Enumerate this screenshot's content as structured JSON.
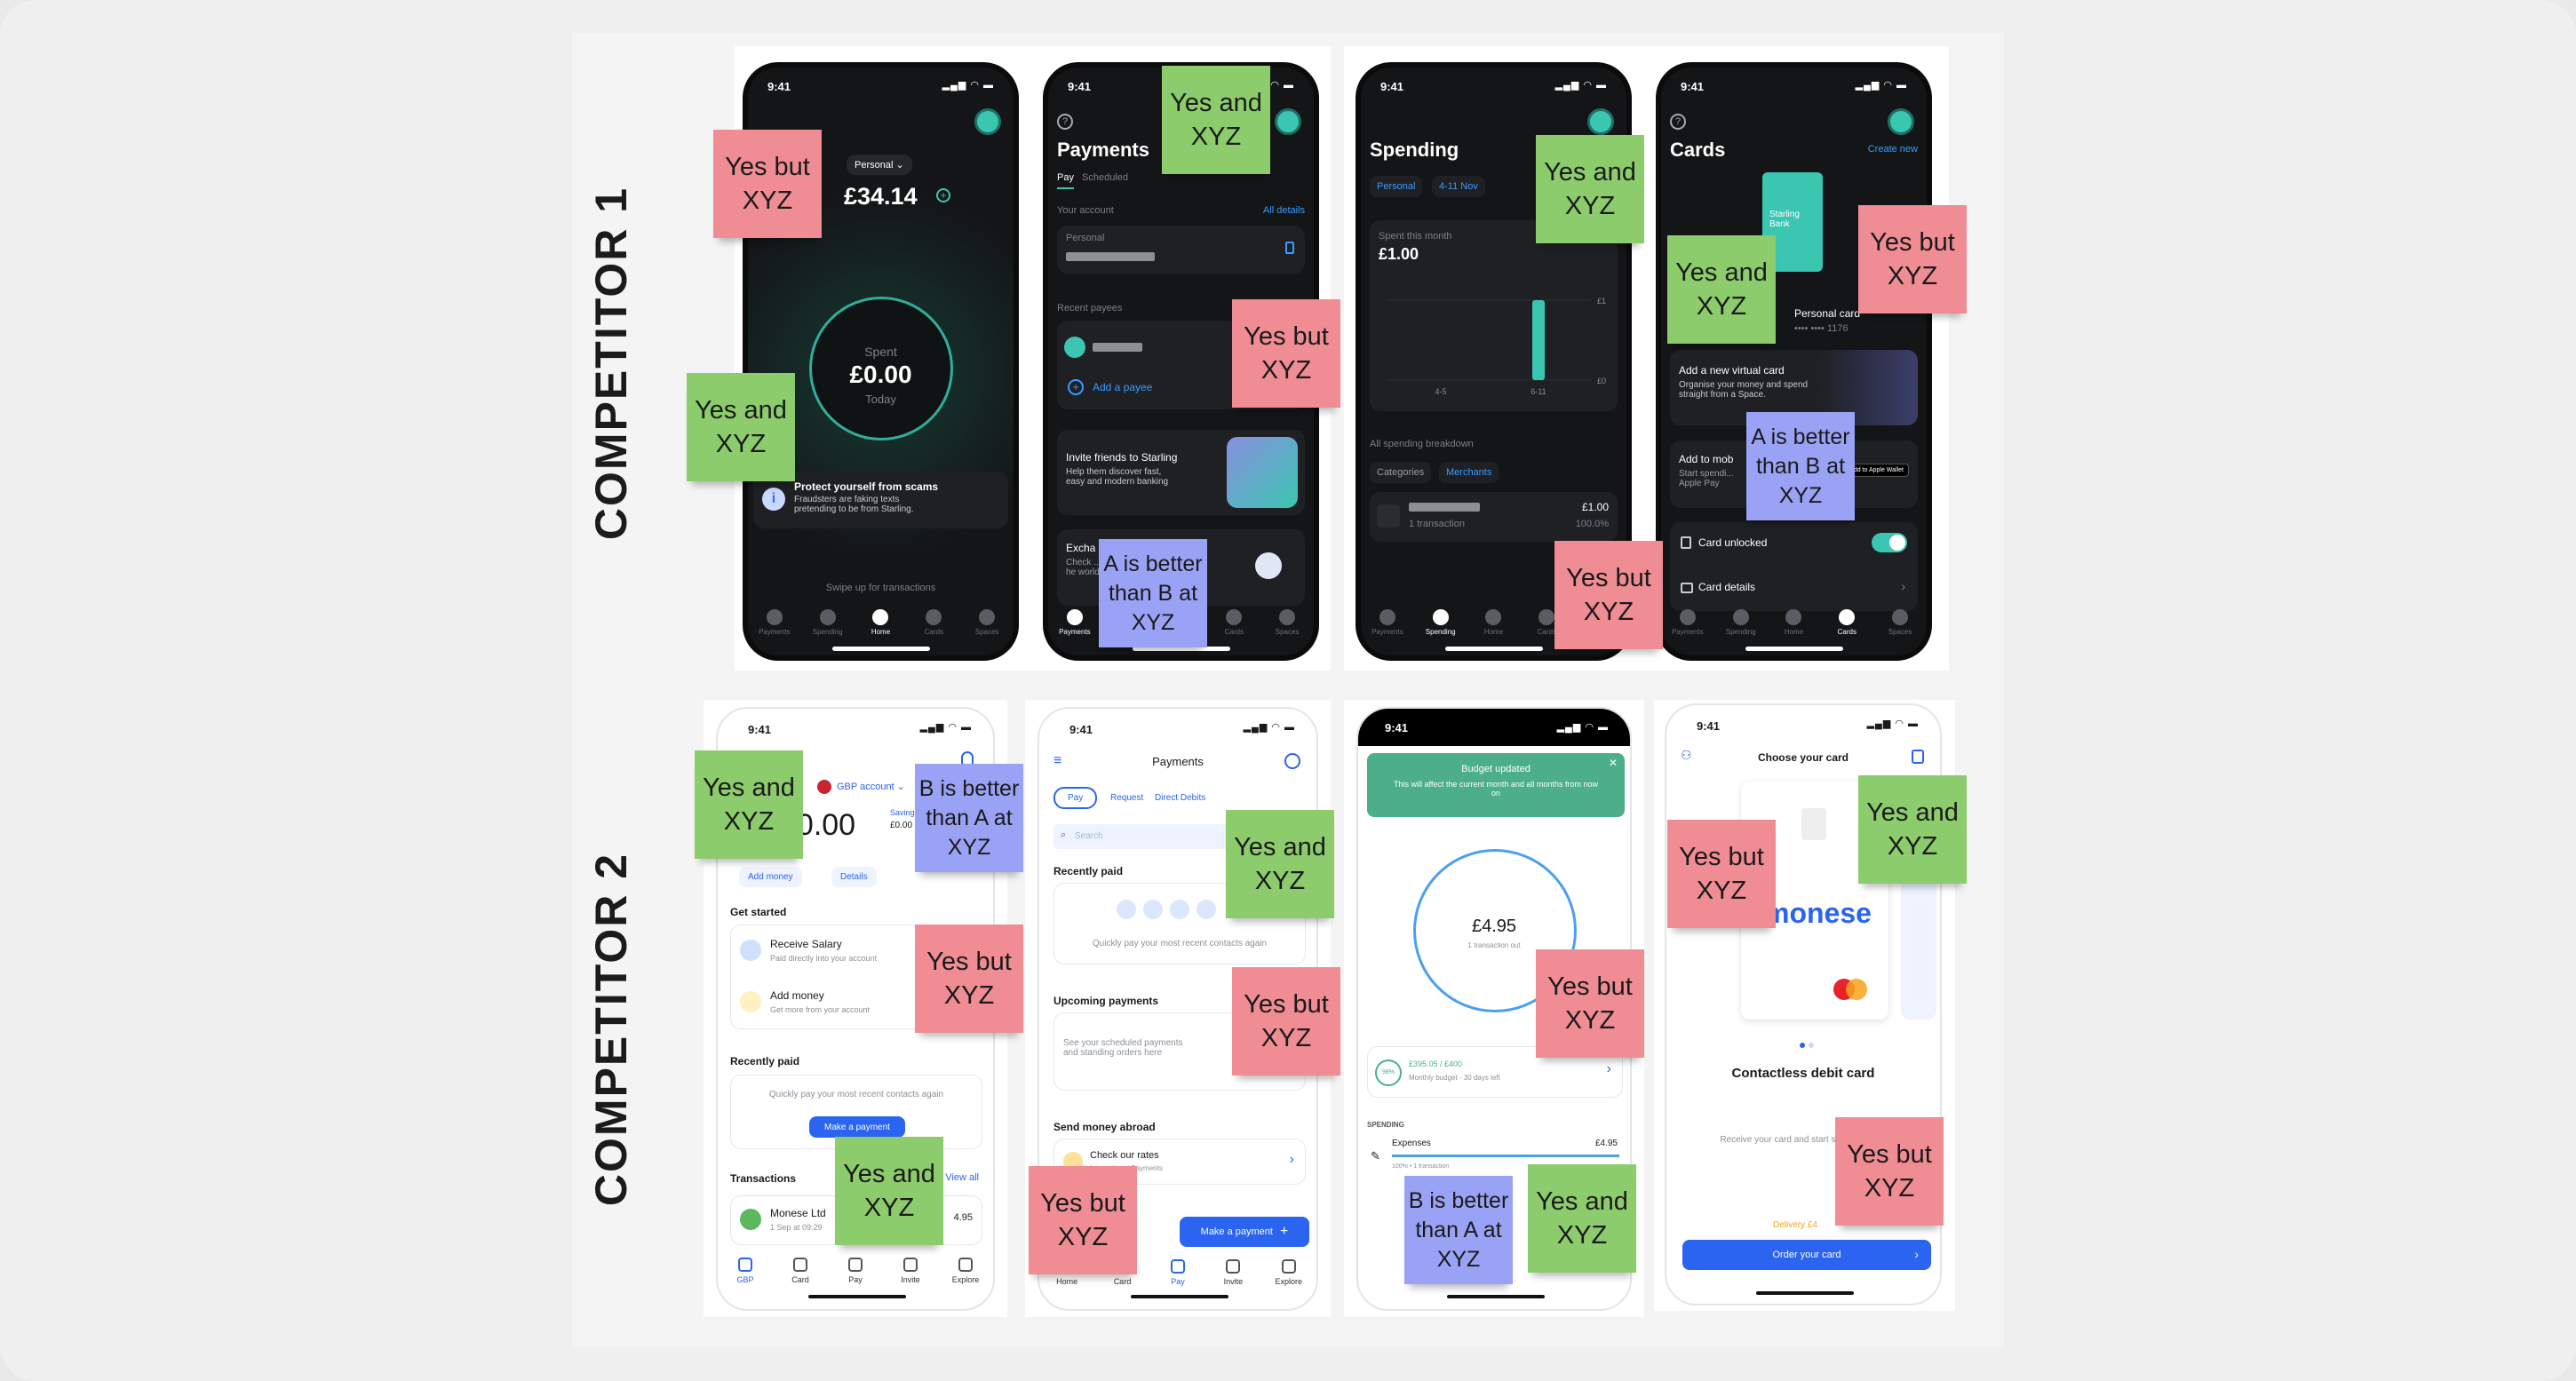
{
  "labels": {
    "competitor_1": "COMPETITOR 1",
    "competitor_2": "COMPETITOR 2"
  },
  "colors": {
    "sticky_pink": "#ef8c94",
    "sticky_green": "#8ccc6c",
    "sticky_blue": "#9aa2f5",
    "starling_teal": "#3bc6b2",
    "monese_blue": "#2a64f0"
  },
  "status_time": "9:41",
  "starling_tabs": [
    "Payments",
    "Spending",
    "Home",
    "Cards",
    "Spaces"
  ],
  "c1_home": {
    "account_pill": "Personal ⌄",
    "balance": "£34.14",
    "spent_label": "Spent",
    "spent_value": "£0.00",
    "spent_period": "Today",
    "scam_title": "Protect yourself from scams",
    "scam_body": "Fraudsters are faking texts pretending to be from Starling.",
    "swipe_hint": "Swipe up for transactions"
  },
  "c1_payments": {
    "title": "Payments",
    "tabs": [
      "Pay",
      "Scheduled"
    ],
    "your_account": "Your account",
    "all_details": "All details",
    "account_name": "Personal",
    "recent_payees": "Recent payees",
    "add_payee": "Add a payee",
    "invite_title": "Invite friends to Starling",
    "invite_body": "Help them discover fast, easy and modern banking",
    "exchange_title": "Excha",
    "exchange_body": "Check ... ates on cu... he world."
  },
  "c1_spending": {
    "title": "Spending",
    "chips": [
      "Personal",
      "4-11 Nov"
    ],
    "spent_label": "Spent this month",
    "spent_value": "£1.00",
    "chart": {
      "categories": [
        "4-5",
        "6-11"
      ],
      "values": [
        0,
        1
      ],
      "y_ticks": [
        "£1",
        "£0"
      ]
    },
    "breakdown_label": "All spending breakdown",
    "breakdown_tabs": [
      "Categories",
      "Merchants"
    ],
    "merchant_sub": "1 transaction",
    "merchant_amount": "£1.00",
    "merchant_pct": "100.0%"
  },
  "c1_cards": {
    "title": "Cards",
    "create_new": "Create new",
    "card_brand": "Starling Bank",
    "card_name": "Personal card",
    "card_number": "•••• •••• 1176",
    "virtual_title": "Add a new virtual card",
    "virtual_body": "Organise your money and spend straight from a Space.",
    "wallet_title": "Add to mob",
    "wallet_body": "Start spendi... Apple Pay",
    "wallet_badge": "Add to Apple Wallet",
    "card_unlocked": "Card unlocked",
    "card_unlocked_on": true,
    "card_details": "Card details"
  },
  "c2_home": {
    "account": "GBP account ⌄",
    "balance": "£0.00",
    "savings_label": "Savings",
    "savings_value": "£0.00",
    "actions": [
      "Add money",
      "Details"
    ],
    "get_started": "Get started",
    "items": [
      {
        "title": "Receive Salary",
        "sub": "Paid directly into your account"
      },
      {
        "title": "Add money",
        "sub": "Get more from your account"
      }
    ],
    "recently_paid": "Recently paid",
    "recent_hint": "Quickly pay your most recent contacts again",
    "make_payment": "Make a payment",
    "transactions": "Transactions",
    "view_all": "View all",
    "tx_name": "Monese Ltd",
    "tx_sub": "1 Sep at 09:29",
    "tx_amount": "4.95",
    "tabs": [
      "GBP",
      "Card",
      "Pay",
      "Invite",
      "Explore"
    ]
  },
  "c2_payments": {
    "title": "Payments",
    "tabs": [
      "Pay",
      "Request",
      "Direct Debits"
    ],
    "search_placeholder": "Search",
    "recently_paid": "Recently paid",
    "recent_hint": "Quickly pay your most recent contacts again",
    "upcoming": "Upcoming payments",
    "upcoming_hint": "See your scheduled payments and standing orders here",
    "abroad": "Send money abroad",
    "rates_title": "Check our rates",
    "rates_sub": "International Payments",
    "make_payment": "Make a payment",
    "bottom_tabs": [
      "Home",
      "Card",
      "Pay",
      "Invite",
      "Explore"
    ]
  },
  "c2_budget": {
    "toast_title": "Budget updated",
    "toast_body": "This will affect the current month and all months from now on",
    "amount": "£4.95",
    "amount_sub": "1 transaction out",
    "budget_pct": "98%",
    "budget_amount": "£395.05 / £400",
    "budget_sub": "Monthly budget · 30 days left",
    "spending_label": "SPENDING",
    "expense_name": "Expenses",
    "expense_amount": "£4.95",
    "expense_sub": "100% • 1 transaction",
    "expense_progress": 1.0
  },
  "c2_card": {
    "title": "Choose your card",
    "brand": "monese",
    "card_type": "Contactless debit card",
    "body": "Receive your card and start s... and online",
    "delivery": "Delivery £4",
    "order_button": "Order your card"
  },
  "stickies": [
    {
      "color": "pink",
      "text": "Yes but XYZ"
    },
    {
      "color": "green",
      "text": "Yes and XYZ"
    },
    {
      "color": "green",
      "text": "Yes and XYZ"
    },
    {
      "color": "pink",
      "text": "Yes but XYZ"
    },
    {
      "color": "blue",
      "text": "A is better than B at XYZ"
    },
    {
      "color": "green",
      "text": "Yes and XYZ"
    },
    {
      "color": "pink",
      "text": "Yes but XYZ"
    },
    {
      "color": "green",
      "text": "Yes and XYZ"
    },
    {
      "color": "pink",
      "text": "Yes but XYZ"
    },
    {
      "color": "blue",
      "text": "A is better than B at XYZ"
    },
    {
      "color": "green",
      "text": "Yes and XYZ"
    },
    {
      "color": "blue",
      "text": "B is better than A at XYZ"
    },
    {
      "color": "pink",
      "text": "Yes but XYZ"
    },
    {
      "color": "green",
      "text": "Yes and XYZ"
    },
    {
      "color": "green",
      "text": "Yes and XYZ"
    },
    {
      "color": "pink",
      "text": "Yes but XYZ"
    },
    {
      "color": "pink",
      "text": "Yes but XYZ"
    },
    {
      "color": "pink",
      "text": "Yes but XYZ"
    },
    {
      "color": "blue",
      "text": "B is better than A at XYZ"
    },
    {
      "color": "green",
      "text": "Yes and XYZ"
    },
    {
      "color": "pink",
      "text": "Yes but XYZ"
    },
    {
      "color": "green",
      "text": "Yes and XYZ"
    },
    {
      "color": "pink",
      "text": "Yes but XYZ"
    }
  ]
}
